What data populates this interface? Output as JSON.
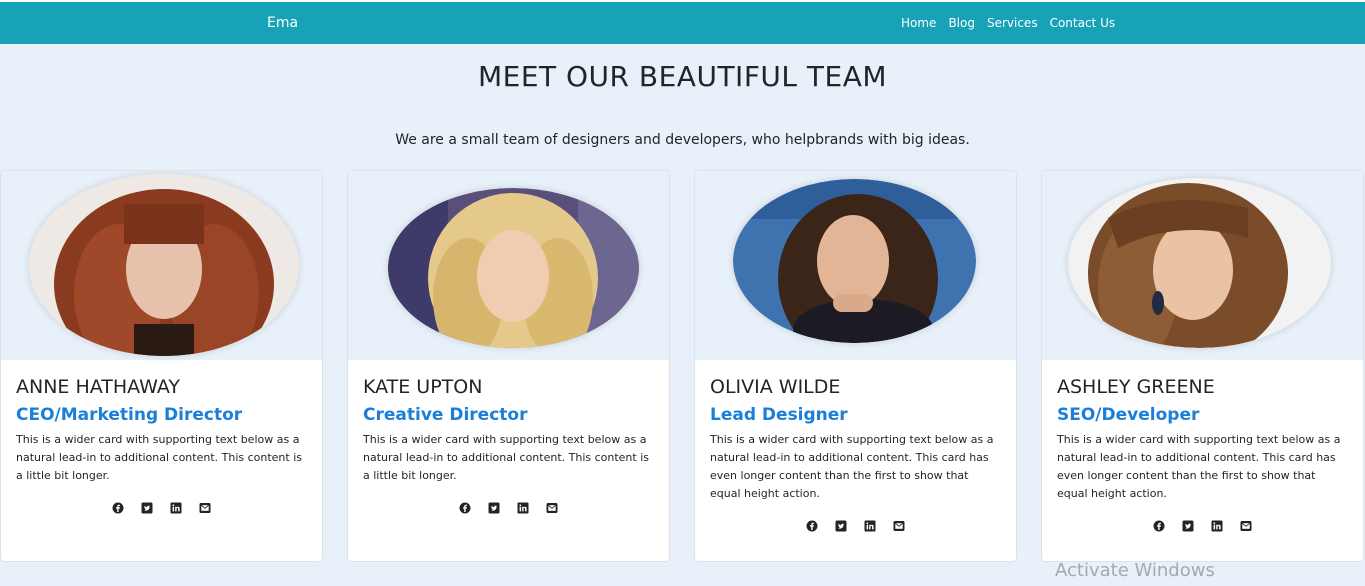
{
  "navbar": {
    "brand": "Ema",
    "links": [
      "Home",
      "Blog",
      "Services",
      "Contact Us"
    ],
    "color": "#17a2b8"
  },
  "hero": {
    "title": "MEET OUR BEAUTIFUL TEAM",
    "subtitle": "We are a small team of designers and developers, who helpbrands with big ideas."
  },
  "team": [
    {
      "name": "ANNE HATHAWAY",
      "role": "CEO/Marketing Director",
      "description": "This is a wider card with supporting text below as a natural lead-in to additional content. This content is a little bit longer.",
      "photo": "portrait-photo-auburn-hair"
    },
    {
      "name": "KATE UPTON",
      "role": "Creative Director",
      "description": "This is a wider card with supporting text below as a natural lead-in to additional content. This content is a little bit longer.",
      "photo": "portrait-photo-blonde-hair"
    },
    {
      "name": "OLIVIA WILDE",
      "role": "Lead Designer",
      "description": "This is a wider card with supporting text below as a natural lead-in to additional content. This card has even longer content than the first to show that equal height action.",
      "photo": "portrait-photo-brunette-smiling"
    },
    {
      "name": "ASHLEY GREENE",
      "role": "SEO/Developer",
      "description": "This is a wider card with supporting text below as a natural lead-in to additional content. This card has even longer content than the first to show that equal height action.",
      "photo": "portrait-photo-light-brown-hair"
    }
  ],
  "social_icons": [
    "facebook-icon",
    "twitter-icon",
    "linkedin-icon",
    "envelope-icon"
  ],
  "role_color": "#1a7fd8",
  "watermark": "Activate Windows"
}
